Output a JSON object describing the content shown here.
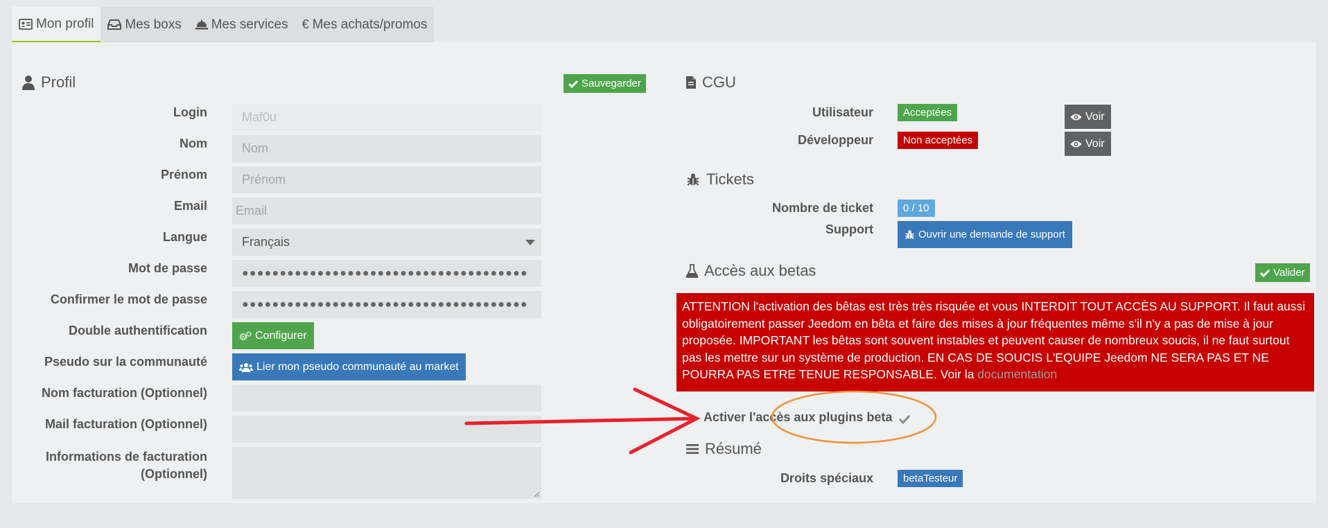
{
  "tabs": [
    {
      "label": "Mon profil",
      "icon": "id-card-icon"
    },
    {
      "label": "Mes boxs",
      "icon": "box-icon"
    },
    {
      "label": "Mes services",
      "icon": "bell-icon"
    },
    {
      "label": "Mes achats/promos",
      "icon": "euro-icon"
    }
  ],
  "profile": {
    "title": "Profil",
    "save_label": "Sauvegarder",
    "login_label": "Login",
    "login_value": "Maf0u",
    "nom_label": "Nom",
    "nom_placeholder": "Nom",
    "prenom_label": "Prénom",
    "prenom_placeholder": "Prénom",
    "email_label": "Email",
    "email_placeholder": "Email",
    "langue_label": "Langue",
    "langue_value": "Français",
    "password_label": "Mot de passe",
    "password_mask": "●●●●●●●●●●●●●●●●●●●●●●●●●●●●●●●●●●●●●●",
    "confirm_label": "Confirmer le mot de passe",
    "confirm_mask": "●●●●●●●●●●●●●●●●●●●●●●●●●●●●●●●●●●●●●●",
    "twofa_label": "Double authentification",
    "configure_label": "Configurer",
    "pseudo_label": "Pseudo sur la communauté",
    "link_pseudo_label": "Lier mon pseudo communauté au market",
    "billing_name_label": "Nom facturation (Optionnel)",
    "billing_mail_label": "Mail facturation (Optionnel)",
    "billing_info_label_1": "Informations de facturation",
    "billing_info_label_2": "(Optionnel)"
  },
  "cgu": {
    "title": "CGU",
    "user_label": "Utilisateur",
    "user_status": "Acceptées",
    "dev_label": "Développeur",
    "dev_status": "Non acceptées",
    "view_label": "Voir"
  },
  "tickets": {
    "title": "Tickets",
    "count_label": "Nombre de ticket",
    "count_value": "0 / 10",
    "support_label": "Support",
    "support_button": "Ouvrir une demande de support"
  },
  "betas": {
    "title": "Accès aux betas",
    "validate_label": "Valider",
    "warning_text": "ATTENTION l'activation des bêtas est très très risquée et vous INTERDIT TOUT ACCÈS AU SUPPORT. Il faut aussi obligatoirement passer Jeedom en bêta et faire des mises à jour fréquentes même s'il n'y a pas de mise à jour proposée. IMPORTANT les bêtas sont souvent instables et peuvent causer de nombreux soucis, il ne faut surtout pas les mettre sur un système de production. EN CAS DE SOUCIS L'EQUIPE Jeedom NE SERA PAS ET NE POURRA PAS ETRE TENUE RESPONSABLE. Voir la ",
    "doc_link": "documentation",
    "plugins_beta_label": "Activer l'accès aux plugins beta",
    "plugins_beta_checked": true
  },
  "resume": {
    "title": "Résumé",
    "rights_label": "Droits spéciaux",
    "rights_value": "betaTesteur"
  },
  "colors": {
    "green": "#4ea54b",
    "blue": "#3978b9",
    "red": "#c70000",
    "grey": "#5f6163",
    "annotation_arrow": "#e8222c",
    "annotation_ellipse": "#f0903a"
  }
}
